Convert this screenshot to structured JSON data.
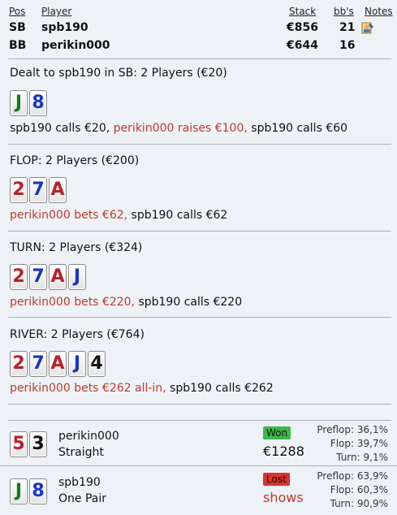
{
  "header": {
    "col_pos": "Pos",
    "col_player": "Player",
    "col_stack": "Stack",
    "col_bbs": "bb's",
    "col_notes": "Notes",
    "rows": [
      {
        "pos": "SB",
        "player": "spb190",
        "stack": "€856",
        "bbs": "21"
      },
      {
        "pos": "BB",
        "player": "perikin000",
        "stack": "€644",
        "bbs": "16"
      }
    ]
  },
  "preflop": {
    "title": "Dealt to spb190 in SB: 2 Players (€20)",
    "cards": [
      {
        "rank": "J",
        "suit": "c"
      },
      {
        "rank": "8",
        "suit": "d"
      }
    ],
    "actions": [
      {
        "text": "spb190 calls €20,",
        "color": "black"
      },
      {
        "text": "perikin000 raises €100,",
        "color": "red"
      },
      {
        "text": "spb190 calls €60",
        "color": "black"
      }
    ]
  },
  "flop": {
    "title": "FLOP: 2 Players (€200)",
    "cards": [
      {
        "rank": "2",
        "suit": "h"
      },
      {
        "rank": "7",
        "suit": "d"
      },
      {
        "rank": "A",
        "suit": "h"
      }
    ],
    "actions": [
      {
        "text": "perikin000 bets €62,",
        "color": "red"
      },
      {
        "text": "spb190 calls €62",
        "color": "black"
      }
    ]
  },
  "turn": {
    "title": "TURN: 2 Players (€324)",
    "cards": [
      {
        "rank": "2",
        "suit": "h"
      },
      {
        "rank": "7",
        "suit": "d"
      },
      {
        "rank": "A",
        "suit": "h"
      },
      {
        "rank": "J",
        "suit": "d"
      }
    ],
    "actions": [
      {
        "text": "perikin000 bets €220,",
        "color": "red"
      },
      {
        "text": "spb190 calls €220",
        "color": "black"
      }
    ]
  },
  "river": {
    "title": "RIVER: 2 Players (€764)",
    "cards": [
      {
        "rank": "2",
        "suit": "h"
      },
      {
        "rank": "7",
        "suit": "d"
      },
      {
        "rank": "A",
        "suit": "h"
      },
      {
        "rank": "J",
        "suit": "d"
      },
      {
        "rank": "4",
        "suit": "s"
      }
    ],
    "actions": [
      {
        "text": "perikin000 bets €262 all-in,",
        "color": "red"
      },
      {
        "text": "spb190 calls €262",
        "color": "black"
      }
    ]
  },
  "results": [
    {
      "player": "perikin000",
      "hand": "Straight",
      "cards": [
        {
          "rank": "5",
          "suit": "h"
        },
        {
          "rank": "3",
          "suit": "s"
        }
      ],
      "badge": "Won",
      "badge_color": "#3cb84a",
      "amount": "€1288",
      "amount_color": "#111",
      "stats": [
        {
          "label": "Preflop:",
          "value": "36,1%"
        },
        {
          "label": "Flop:",
          "value": "39,7%"
        },
        {
          "label": "Turn:",
          "value": "9,1%"
        }
      ]
    },
    {
      "player": "spb190",
      "hand": "One Pair",
      "cards": [
        {
          "rank": "J",
          "suit": "c"
        },
        {
          "rank": "8",
          "suit": "d"
        }
      ],
      "badge": "Lost",
      "badge_color": "#d9332e",
      "amount": "shows",
      "amount_color": "#c0392b",
      "stats": [
        {
          "label": "Preflop:",
          "value": "63,9%"
        },
        {
          "label": "Flop:",
          "value": "60,3%"
        },
        {
          "label": "Turn:",
          "value": "90,9%"
        }
      ]
    }
  ]
}
